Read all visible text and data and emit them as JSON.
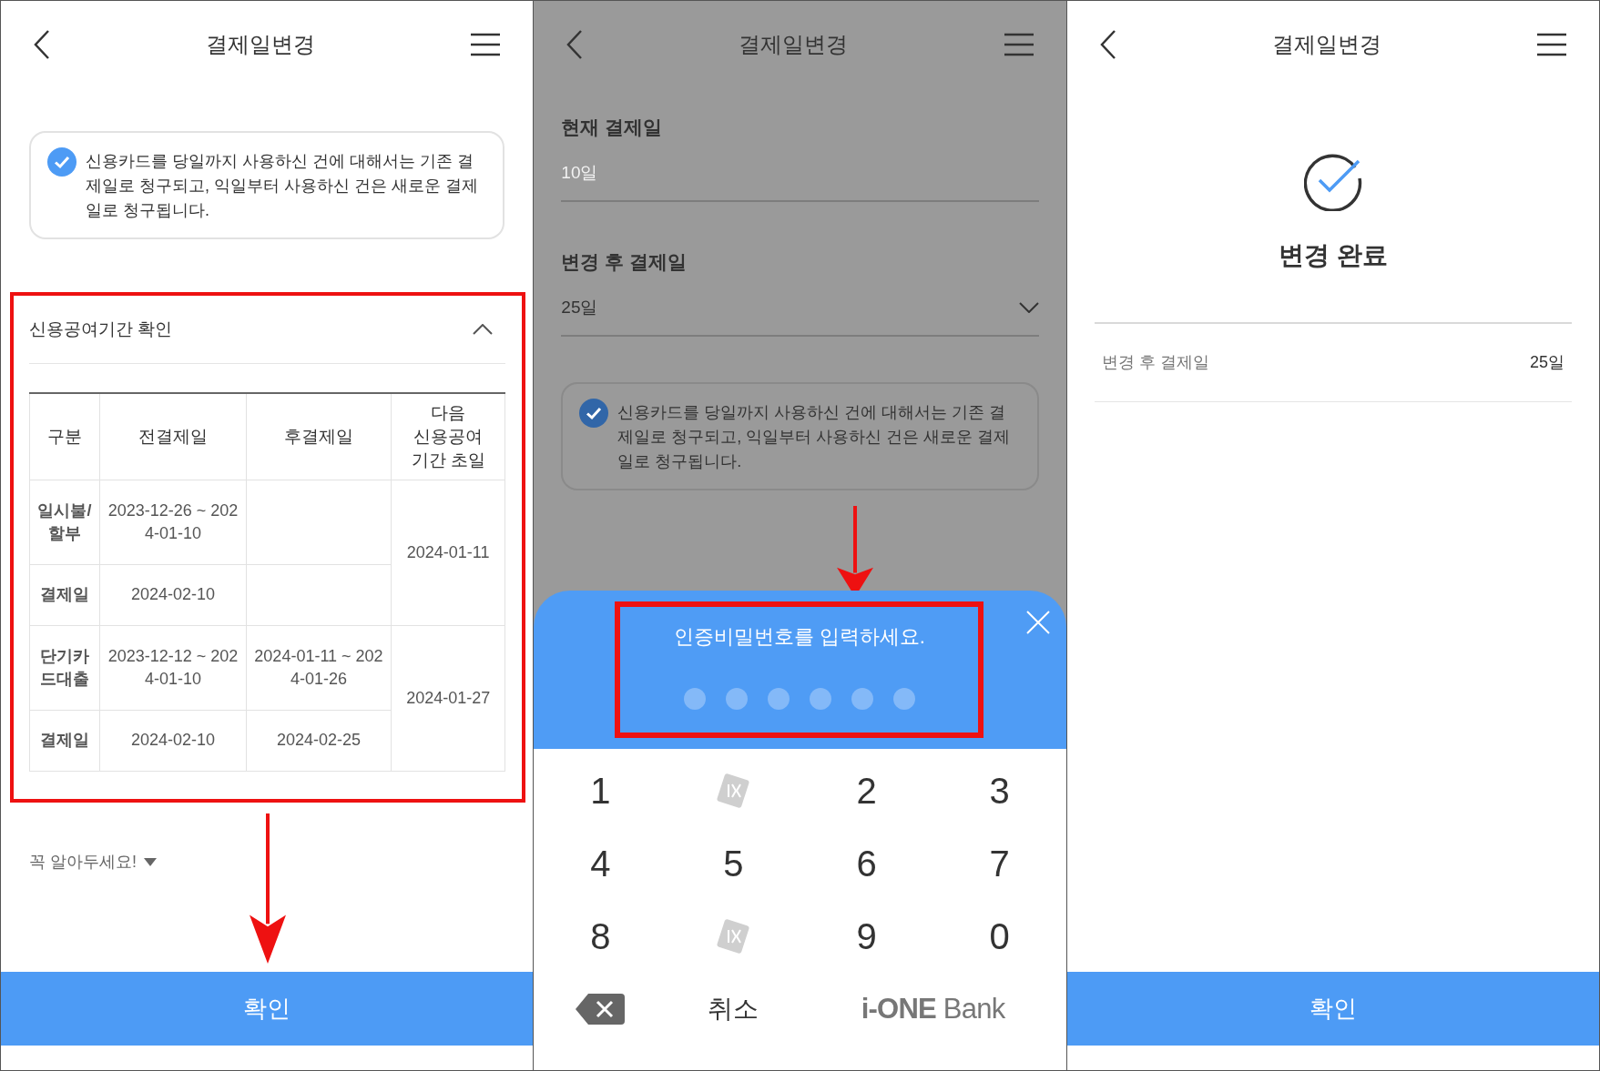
{
  "screens": [
    {
      "kind": "info",
      "header": {
        "title": "결제일변경"
      },
      "notice": {
        "checked": true,
        "text": "신용카드를 당일까지 사용하신 건에 대해서는 기존 결제일로 청구되고, 익일부터 사용하신 건은 새로운 결제일로 청구됩니다."
      },
      "section": {
        "title": "신용공여기간 확인",
        "expanded": true,
        "highlighted": true,
        "table": {
          "columns": [
            "구분",
            "전결제일",
            "후결제일",
            "다음 신용공여 기간 초일"
          ],
          "groups": [
            {
              "rows": [
                {
                  "category": "일시불/할부",
                  "before": "2023-12-26 ~ 2024-01-10"
                },
                {
                  "category": "결제일",
                  "before": "2024-02-10"
                }
              ],
              "next_start": "2024-01-11"
            },
            {
              "rows": [
                {
                  "category": "단기카드대출",
                  "before": "2023-12-12 ~ 2024-01-10",
                  "after": "2024-01-11 ~ 2024-01-26"
                },
                {
                  "category": "결제일",
                  "before": "2024-02-10",
                  "after": "2024-02-25"
                }
              ],
              "next_start": "2024-01-27"
            }
          ]
        }
      },
      "tip": {
        "text": "꼭 알아두세요!",
        "expanded": false
      },
      "confirm": "확인"
    },
    {
      "kind": "form",
      "dimmed": true,
      "header": {
        "title": "결제일변경"
      },
      "fields": [
        {
          "kind": "static",
          "label": "현재 결제일",
          "value": "10일"
        },
        {
          "kind": "select",
          "label": "변경 후 결제일",
          "value": "25일"
        }
      ],
      "notice": {
        "checked": true,
        "text": "신용카드를 당일까지 사용하신 건에 대해서는 기존 결제일로 청구되고, 익일부터 사용하신 건은 새로운 결제일로 청구됩니다."
      },
      "pin_sheet": {
        "prompt": "인증비밀번호를 입력하세요.",
        "highlighted": true,
        "digits": [
          {
            "filled": false
          },
          {
            "filled": false
          },
          {
            "filled": false
          },
          {
            "filled": false
          },
          {
            "filled": false
          },
          {
            "filled": false
          }
        ],
        "keys": [
          {
            "kind": "digit",
            "label": "1"
          },
          {
            "kind": "logo"
          },
          {
            "kind": "digit",
            "label": "2"
          },
          {
            "kind": "digit",
            "label": "3"
          },
          {
            "kind": "digit",
            "label": "4"
          },
          {
            "kind": "digit",
            "label": "5"
          },
          {
            "kind": "digit",
            "label": "6"
          },
          {
            "kind": "digit",
            "label": "7"
          },
          {
            "kind": "digit",
            "label": "8"
          },
          {
            "kind": "logo"
          },
          {
            "kind": "digit",
            "label": "9"
          },
          {
            "kind": "digit",
            "label": "0"
          },
          {
            "kind": "backspace"
          },
          {
            "kind": "text",
            "label": "취소"
          },
          {
            "kind": "brand",
            "label": "**i-ONE** Bank"
          }
        ]
      }
    },
    {
      "kind": "done",
      "header": {
        "title": "결제일변경"
      },
      "status": "변경 완료",
      "summary": [
        {
          "label": "변경 후 결제일",
          "value": "25일"
        }
      ],
      "confirm": "확인"
    }
  ]
}
